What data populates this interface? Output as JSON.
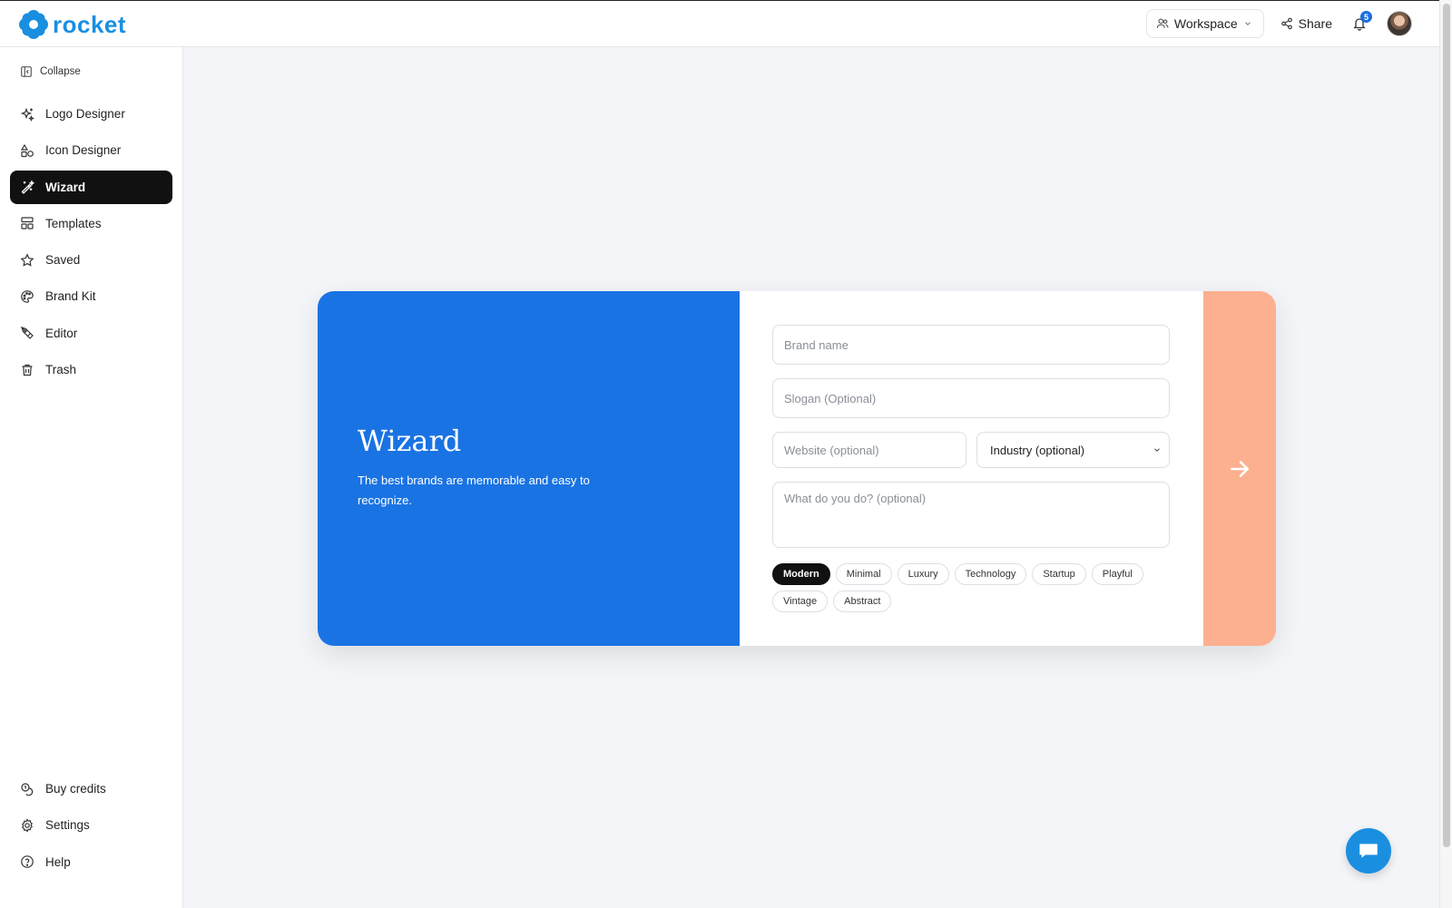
{
  "brand": {
    "name": "rocket",
    "color": "#1a8fe0"
  },
  "topbar": {
    "workspace_label": "Workspace",
    "share_label": "Share",
    "notification_count": "5"
  },
  "sidebar": {
    "collapse_label": "Collapse",
    "items": [
      {
        "label": "Logo Designer",
        "icon": "sparkles-icon"
      },
      {
        "label": "Icon Designer",
        "icon": "shapes-icon"
      },
      {
        "label": "Wizard",
        "icon": "magic-wand-icon",
        "active": true
      },
      {
        "label": "Templates",
        "icon": "layout-icon"
      },
      {
        "label": "Saved",
        "icon": "star-icon"
      },
      {
        "label": "Brand Kit",
        "icon": "palette-icon"
      },
      {
        "label": "Editor",
        "icon": "pen-tool-icon"
      },
      {
        "label": "Trash",
        "icon": "trash-icon"
      }
    ],
    "bottom_items": [
      {
        "label": "Buy credits",
        "icon": "coins-icon"
      },
      {
        "label": "Settings",
        "icon": "gear-icon"
      },
      {
        "label": "Help",
        "icon": "help-circle-icon"
      }
    ]
  },
  "wizard": {
    "title": "Wizard",
    "subtitle": "The best brands are memorable and easy to recognize.",
    "brand_name_placeholder": "Brand name",
    "slogan_placeholder": "Slogan (Optional)",
    "website_placeholder": "Website (optional)",
    "industry_value": "Industry (optional)",
    "description_placeholder": "What do you do? (optional)",
    "styles": [
      "Modern",
      "Minimal",
      "Luxury",
      "Technology",
      "Startup",
      "Playful",
      "Vintage",
      "Abstract"
    ],
    "selected_style": "Modern",
    "colors": {
      "left_panel": "#1a73e3",
      "next_panel": "#fdb08f"
    }
  }
}
